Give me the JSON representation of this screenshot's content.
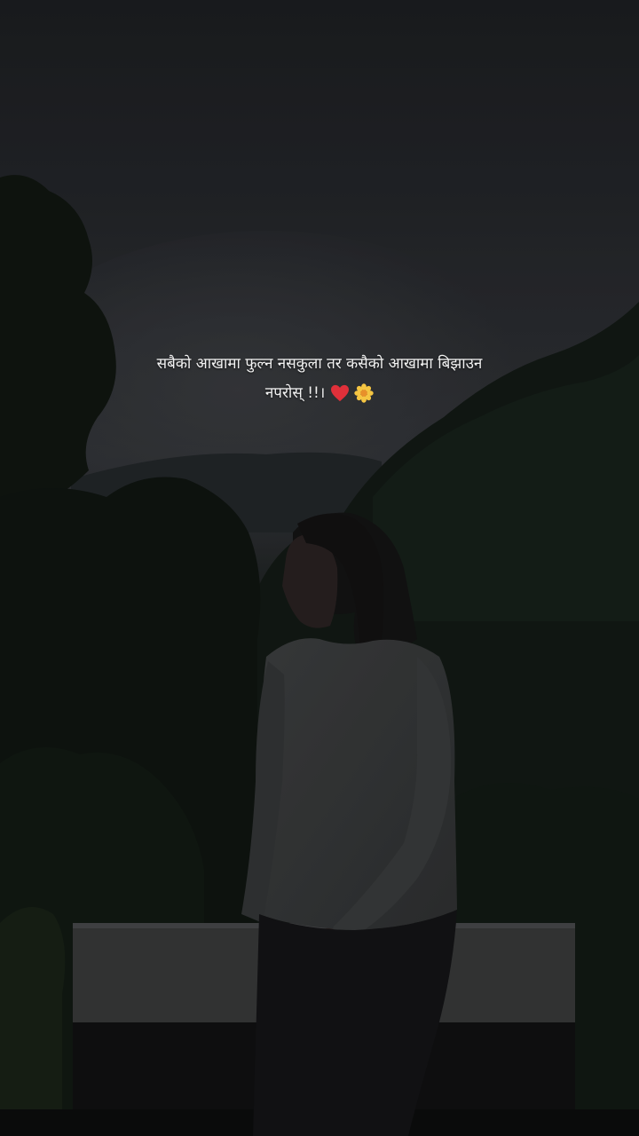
{
  "story": {
    "caption_line1": "सबैको आखामा फुल्न नसकुला तर कसैको आखामा बिझाउन",
    "caption_line2": "नपरोस् !!।",
    "caption_emojis": [
      "heart",
      "blossom"
    ]
  },
  "colors": {
    "caption_text": "#f2f2f2",
    "heart": "#e0303a",
    "blossom": "#f5c542"
  }
}
